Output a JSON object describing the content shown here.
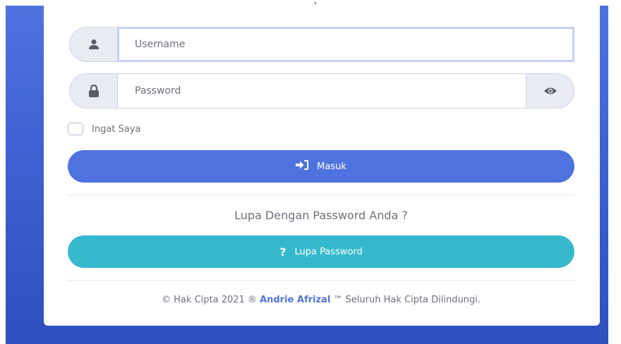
{
  "login_form": {
    "username_placeholder": "Username",
    "password_placeholder": "Password",
    "remember_label": "Ingat Saya",
    "login_button_label": "Masuk",
    "forgot_prompt": "Lupa Dengan Password Anda ?",
    "forgot_button_label": "Lupa Password"
  },
  "icons": {
    "username": "user-icon",
    "password": "lock-icon",
    "toggle_password": "eye-icon",
    "login": "sign-in-icon",
    "forgot": "question-icon"
  },
  "footer": {
    "prefix": "© Hak Cipta 2021 ® ",
    "author": "Andrie Afrizal",
    "suffix": " ™ Seluruh Hak Cipta Dilindungi."
  },
  "colors": {
    "primary": "#4e73df",
    "info": "#36b9cc",
    "background": "#4e73df"
  }
}
